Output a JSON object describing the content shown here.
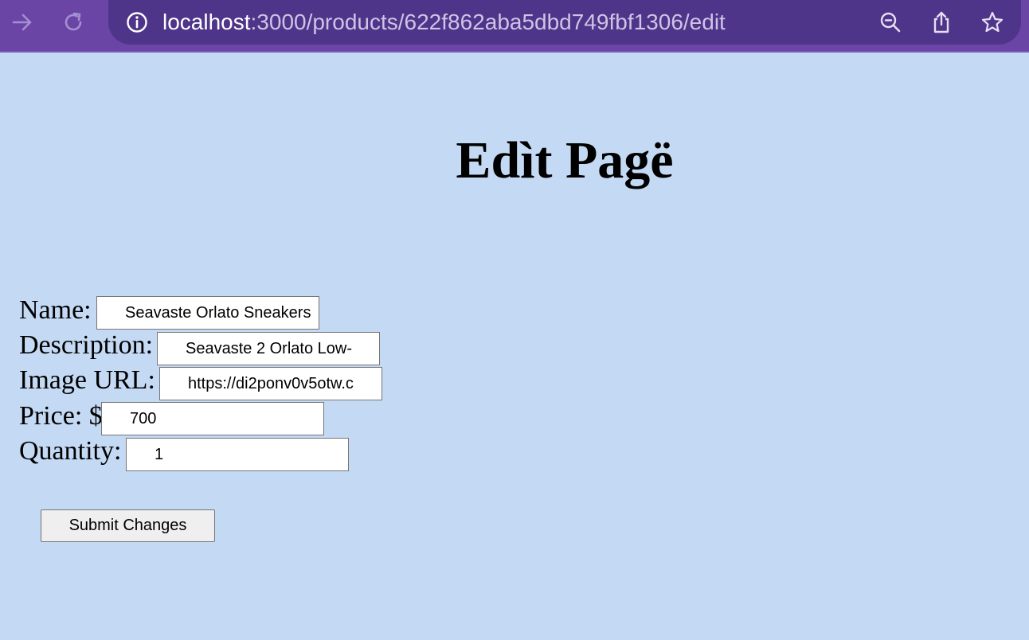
{
  "browser": {
    "url_host": "localhost",
    "url_path": ":3000/products/622f862aba5dbd749fbf1306/edit",
    "icons": [
      "forward-arrow-icon",
      "reload-icon",
      "site-info-icon",
      "zoom-icon",
      "share-icon",
      "bookmark-star-icon"
    ],
    "colors": {
      "toolbar": "#6a45a6",
      "omnibox": "#4f3589"
    }
  },
  "page": {
    "title": "Edìt Pagë",
    "background": "#c4d9f3"
  },
  "form": {
    "name_label": "Name:",
    "name_value": "Seavaste Orlato Sneakers",
    "description_label": "Description:",
    "description_value": "Seavaste 2 Orlato Low-",
    "image_label": "Image URL:",
    "image_value": "https://di2ponv0v5otw.c",
    "price_label": "Price: $",
    "price_value": "700",
    "quantity_label": "Quantity:",
    "quantity_value": "1",
    "submit_label": "Submit Changes"
  }
}
